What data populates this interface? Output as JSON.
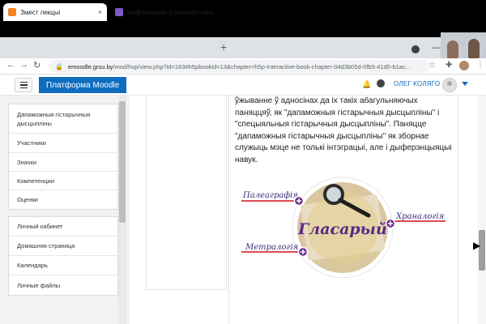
{
  "browser": {
    "tabs": [
      {
        "title": "Змест лекцыі",
        "active": true
      },
      {
        "title": "Информация о разработчиках ...",
        "active": false
      }
    ],
    "new_tab_icon": "+",
    "url_host": "emoodle.grsu.by",
    "url_path": "/mod/hvp/view.php?id=163#h5pbookid=13&chapter=h5p-interactive-book-chapter-04d3b05d-0fb5-41d0-b1ac...",
    "icons": {
      "back": "←",
      "forward": "→",
      "reload": "↻",
      "lock": "🔒",
      "star": "☆",
      "extensions": "✚",
      "menu": "⋮",
      "close": "×",
      "minimize": "—"
    }
  },
  "moodle": {
    "brand": "Платформа Moodle",
    "user_name": "ОЛЕГ КОЛЯГО",
    "bell_icon": "🔔",
    "brand_color": "#0f6cbf"
  },
  "drawer": {
    "group1": [
      "Дапаможныя гістарычныя дысцыпліны",
      "Участники",
      "Значки",
      "Компетенции",
      "Оценки"
    ],
    "group2": [
      "Личный кабинет",
      "Домашняя страница",
      "Календарь",
      "Личные файлы"
    ]
  },
  "content": {
    "paragraph": "ўжыванне ў адносінах да іх такіх абагульняючых паняццяў, як \"дапаможныя гістарычныя дысцыпліны\" і \"спецыяльныя гістарычныя дысцыпліны\". Паняцце \"дапаможныя гістарычныя дысцыпліны\" як зборнае служыць мэце не толькі інтэграцыі, але і дыферэнцыяцыі навук.",
    "graphic": {
      "center_label": "Гласарый",
      "label_left_top": "Палеаграфія",
      "label_left_bottom": "Метралогія",
      "label_right": "Храналогія",
      "accent_color": "#6a2c91",
      "line_color": "#d0101b"
    }
  }
}
